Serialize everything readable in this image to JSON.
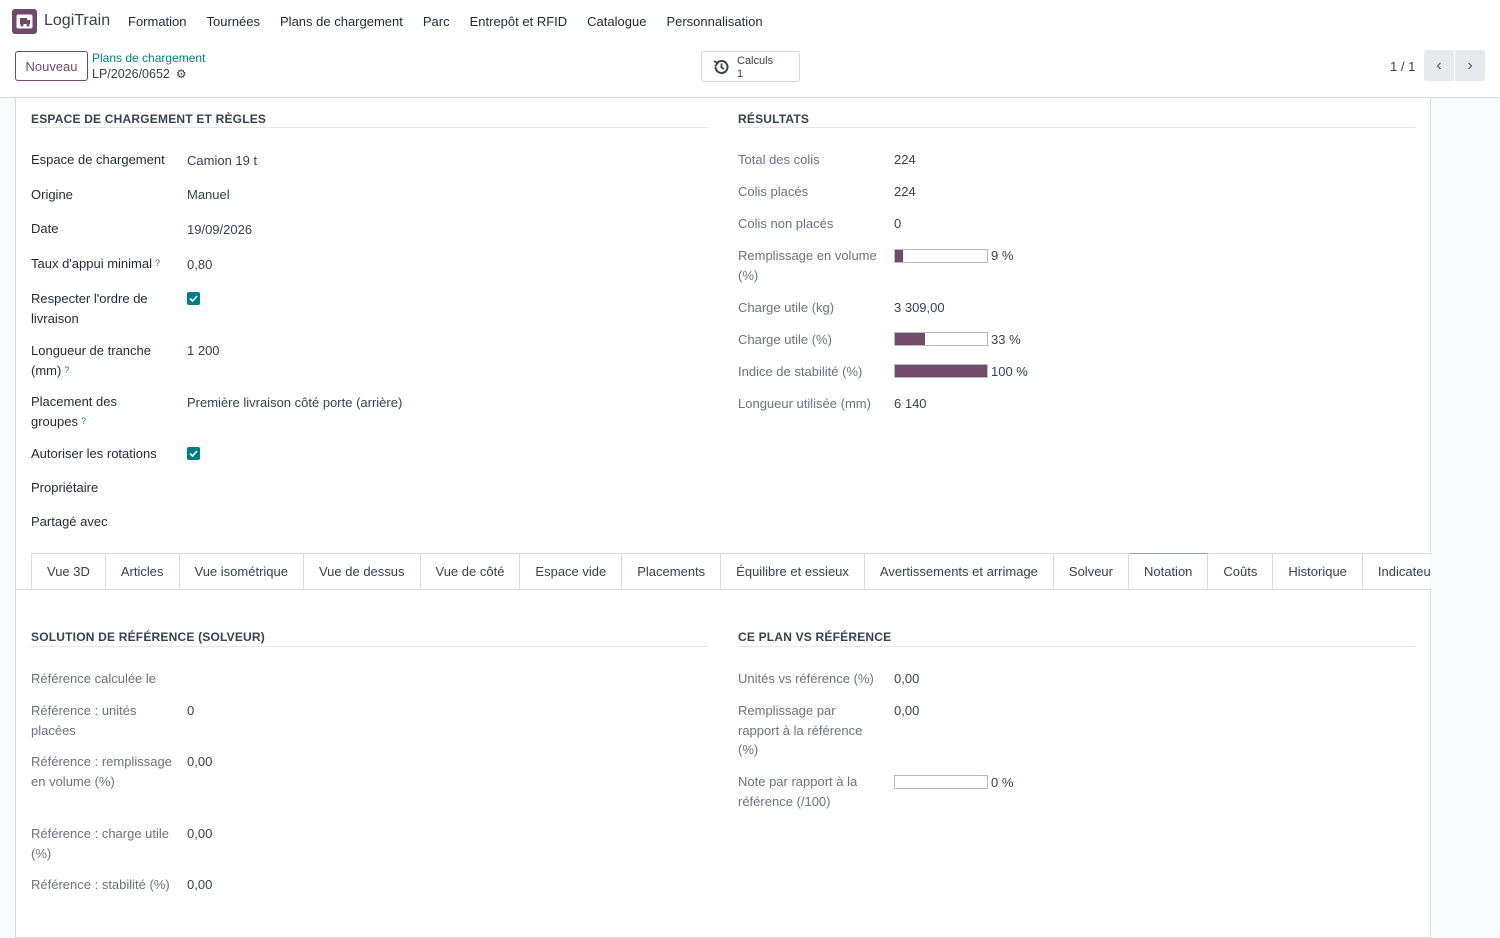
{
  "app": {
    "name": "LogiTrain",
    "logo_icon": "truck-icon",
    "accent": "#714b67",
    "link_color": "#017e84"
  },
  "menu": [
    "Formation",
    "Tournées",
    "Plans de chargement",
    "Parc",
    "Entrepôt et RFID",
    "Catalogue",
    "Personnalisation"
  ],
  "control": {
    "new_label": "Nouveau",
    "breadcrumb_parent": "Plans de chargement",
    "breadcrumb_current": "LP/2026/0652",
    "smart_button": {
      "label": "Calculs",
      "value": "1",
      "icon": "history-icon"
    },
    "pager": "1 / 1"
  },
  "left_group": {
    "title": "ESPACE DE CHARGEMENT ET RÈGLES",
    "fields": [
      {
        "label": "Espace de chargement",
        "value": "Camion 19 t"
      },
      {
        "label": "Origine",
        "value": "Manuel"
      },
      {
        "label": "Date",
        "value": "19/09/2026"
      },
      {
        "label": "Taux d'appui minimal",
        "value": "0,80",
        "help": "?"
      },
      {
        "label": "Respecter l'ordre de livraison",
        "checked": true
      },
      {
        "label": "Longueur de tranche (mm)",
        "value": "1 200",
        "help": "?"
      },
      {
        "label": "Placement des groupes",
        "value": "Première livraison côté porte (arrière)",
        "help": "?"
      },
      {
        "label": "Autoriser les rotations",
        "checked": true
      },
      {
        "label": "Propriétaire",
        "value": ""
      },
      {
        "label": "Partagé avec",
        "value": ""
      }
    ]
  },
  "right_group": {
    "title": "RÉSULTATS",
    "fields": [
      {
        "label": "Total des colis",
        "value": "224"
      },
      {
        "label": "Colis placés",
        "value": "224"
      },
      {
        "label": "Colis non placés",
        "value": "0"
      },
      {
        "label": "Remplissage en volume (%)",
        "progress": 9,
        "progress_text": "9 %"
      },
      {
        "label": "Charge utile (kg)",
        "value": "3 309,00"
      },
      {
        "label": "Charge utile (%)",
        "progress": 33,
        "progress_text": "33 %"
      },
      {
        "label": "Indice de stabilité (%)",
        "progress": 100,
        "progress_text": "100 %"
      },
      {
        "label": "Longueur utilisée (mm)",
        "value": "6 140"
      }
    ]
  },
  "tabs": [
    "Vue 3D",
    "Articles",
    "Vue isométrique",
    "Vue de dessus",
    "Vue de côté",
    "Espace vide",
    "Placements",
    "Équilibre et essieux",
    "Avertissements et arrimage",
    "Solveur",
    "Notation",
    "Coûts",
    "Historique",
    "Indicateurs"
  ],
  "active_tab": "Notation",
  "reference_group": {
    "title": "SOLUTION DE RÉFÉRENCE (SOLVEUR)",
    "fields": [
      {
        "label": "Référence calculée le",
        "value": ""
      },
      {
        "label": "Référence : unités placées",
        "value": "0"
      },
      {
        "label": "Référence : remplissage en volume (%)",
        "value": "0,00"
      },
      {
        "label": "Référence : charge utile (%)",
        "value": "0,00"
      },
      {
        "label": "Référence : stabilité (%)",
        "value": "0,00"
      }
    ]
  },
  "compare_group": {
    "title": "CE PLAN VS RÉFÉRENCE",
    "fields": [
      {
        "label": "Unités vs référence (%)",
        "value": "0,00"
      },
      {
        "label": "Remplissage par rapport à la référence (%)",
        "value": "0,00"
      },
      {
        "label": "Note par rapport à la référence (/100)",
        "progress": 0,
        "progress_text": "0 %"
      }
    ]
  }
}
